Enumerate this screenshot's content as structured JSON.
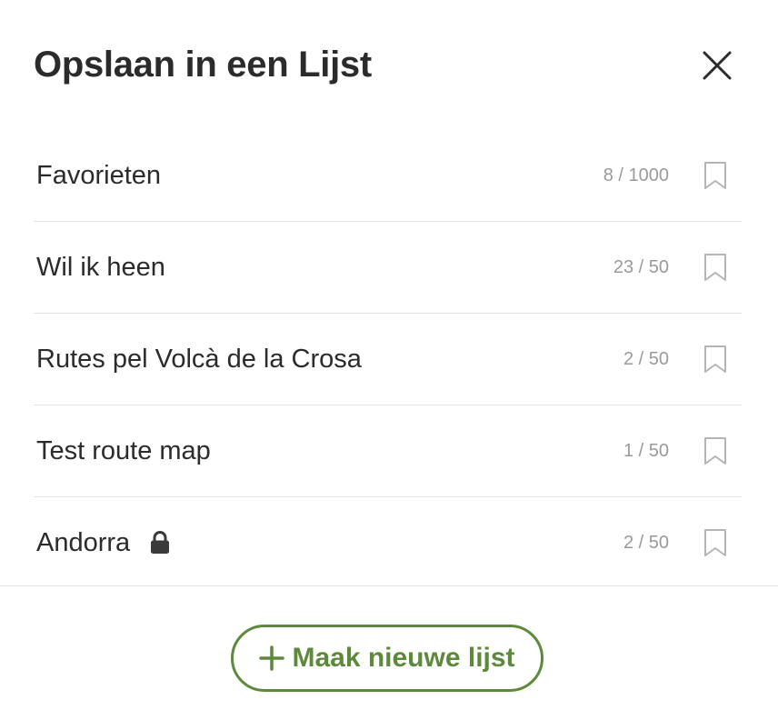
{
  "dialog": {
    "title": "Opslaan in een Lijst",
    "close_icon": "close-icon"
  },
  "lists": [
    {
      "name": "Favorieten",
      "count": "8 / 1000",
      "locked": false,
      "bookmark_icon": "bookmark-outline-icon"
    },
    {
      "name": "Wil ik heen",
      "count": "23 / 50",
      "locked": false,
      "bookmark_icon": "bookmark-outline-icon"
    },
    {
      "name": "Rutes pel Volcà de la Crosa",
      "count": "2 / 50",
      "locked": false,
      "bookmark_icon": "bookmark-outline-icon"
    },
    {
      "name": "Test route map",
      "count": "1 / 50",
      "locked": false,
      "bookmark_icon": "bookmark-outline-icon"
    },
    {
      "name": "Andorra",
      "count": "2 / 50",
      "locked": true,
      "bookmark_icon": "bookmark-outline-icon"
    }
  ],
  "footer": {
    "new_list_label": "Maak nieuwe lijst",
    "new_list_icon": "plus-icon"
  },
  "colors": {
    "accent_green": "#5d8a3a",
    "text_primary": "#2b2b2b",
    "text_muted": "#9a9a9a",
    "divider": "#e2e2e2",
    "bookmark_stroke": "#b5b5b5"
  }
}
